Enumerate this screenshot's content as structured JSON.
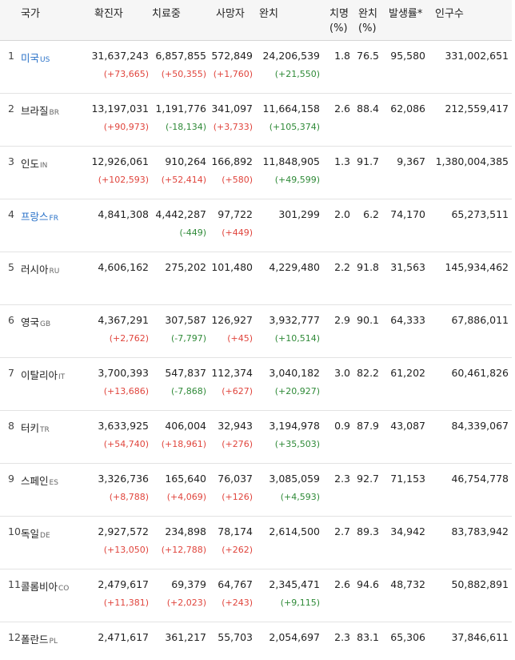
{
  "headers": {
    "country": "국가",
    "confirmed": "확진자",
    "treating": "치료중",
    "deaths": "사망자",
    "recovered": "완치",
    "cfr": "치명\n(%)",
    "recovery_rate": "완치\n(%)",
    "incidence": "발생률*",
    "population": "인구수"
  },
  "rows": [
    {
      "rank": "1",
      "name": "미국",
      "code": "US",
      "link": true,
      "confirmed": "31,637,243",
      "confirmed_delta": "(+73,665)",
      "treating": "6,857,855",
      "treating_delta": "(+50,355)",
      "deaths": "572,849",
      "deaths_delta": "(+1,760)",
      "recovered": "24,206,539",
      "recovered_delta": "(+21,550)",
      "cfr": "1.8",
      "recovery_rate": "76.5",
      "incidence": "95,580",
      "population": "331,002,651"
    },
    {
      "rank": "2",
      "name": "브라질",
      "code": "BR",
      "link": false,
      "confirmed": "13,197,031",
      "confirmed_delta": "(+90,973)",
      "treating": "1,191,776",
      "treating_delta": "(-18,134)",
      "deaths": "341,097",
      "deaths_delta": "(+3,733)",
      "recovered": "11,664,158",
      "recovered_delta": "(+105,374)",
      "cfr": "2.6",
      "recovery_rate": "88.4",
      "incidence": "62,086",
      "population": "212,559,417"
    },
    {
      "rank": "3",
      "name": "인도",
      "code": "IN",
      "link": false,
      "confirmed": "12,926,061",
      "confirmed_delta": "(+102,593)",
      "treating": "910,264",
      "treating_delta": "(+52,414)",
      "deaths": "166,892",
      "deaths_delta": "(+580)",
      "recovered": "11,848,905",
      "recovered_delta": "(+49,599)",
      "cfr": "1.3",
      "recovery_rate": "91.7",
      "incidence": "9,367",
      "population": "1,380,004,385"
    },
    {
      "rank": "4",
      "name": "프랑스",
      "code": "FR",
      "link": true,
      "confirmed": "4,841,308",
      "confirmed_delta": "",
      "treating": "4,442,287",
      "treating_delta": "(-449)",
      "deaths": "97,722",
      "deaths_delta": "(+449)",
      "recovered": "301,299",
      "recovered_delta": "",
      "cfr": "2.0",
      "recovery_rate": "6.2",
      "incidence": "74,170",
      "population": "65,273,511"
    },
    {
      "rank": "5",
      "name": "러시아",
      "code": "RU",
      "link": false,
      "confirmed": "4,606,162",
      "confirmed_delta": "",
      "treating": "275,202",
      "treating_delta": "",
      "deaths": "101,480",
      "deaths_delta": "",
      "recovered": "4,229,480",
      "recovered_delta": "",
      "cfr": "2.2",
      "recovery_rate": "91.8",
      "incidence": "31,563",
      "population": "145,934,462"
    },
    {
      "rank": "6",
      "name": "영국",
      "code": "GB",
      "link": false,
      "confirmed": "4,367,291",
      "confirmed_delta": "(+2,762)",
      "treating": "307,587",
      "treating_delta": "(-7,797)",
      "deaths": "126,927",
      "deaths_delta": "(+45)",
      "recovered": "3,932,777",
      "recovered_delta": "(+10,514)",
      "cfr": "2.9",
      "recovery_rate": "90.1",
      "incidence": "64,333",
      "population": "67,886,011"
    },
    {
      "rank": "7",
      "name": "이탈리아",
      "code": "IT",
      "link": false,
      "confirmed": "3,700,393",
      "confirmed_delta": "(+13,686)",
      "treating": "547,837",
      "treating_delta": "(-7,868)",
      "deaths": "112,374",
      "deaths_delta": "(+627)",
      "recovered": "3,040,182",
      "recovered_delta": "(+20,927)",
      "cfr": "3.0",
      "recovery_rate": "82.2",
      "incidence": "61,202",
      "population": "60,461,826"
    },
    {
      "rank": "8",
      "name": "터키",
      "code": "TR",
      "link": false,
      "confirmed": "3,633,925",
      "confirmed_delta": "(+54,740)",
      "treating": "406,004",
      "treating_delta": "(+18,961)",
      "deaths": "32,943",
      "deaths_delta": "(+276)",
      "recovered": "3,194,978",
      "recovered_delta": "(+35,503)",
      "cfr": "0.9",
      "recovery_rate": "87.9",
      "incidence": "43,087",
      "population": "84,339,067"
    },
    {
      "rank": "9",
      "name": "스페인",
      "code": "ES",
      "link": false,
      "confirmed": "3,326,736",
      "confirmed_delta": "(+8,788)",
      "treating": "165,640",
      "treating_delta": "(+4,069)",
      "deaths": "76,037",
      "deaths_delta": "(+126)",
      "recovered": "3,085,059",
      "recovered_delta": "(+4,593)",
      "cfr": "2.3",
      "recovery_rate": "92.7",
      "incidence": "71,153",
      "population": "46,754,778"
    },
    {
      "rank": "10",
      "name": "독일",
      "code": "DE",
      "link": false,
      "confirmed": "2,927,572",
      "confirmed_delta": "(+13,050)",
      "treating": "234,898",
      "treating_delta": "(+12,788)",
      "deaths": "78,174",
      "deaths_delta": "(+262)",
      "recovered": "2,614,500",
      "recovered_delta": "",
      "cfr": "2.7",
      "recovery_rate": "89.3",
      "incidence": "34,942",
      "population": "83,783,942"
    },
    {
      "rank": "11",
      "name": "콜롬비아",
      "code": "CO",
      "link": false,
      "confirmed": "2,479,617",
      "confirmed_delta": "(+11,381)",
      "treating": "69,379",
      "treating_delta": "(+2,023)",
      "deaths": "64,767",
      "deaths_delta": "(+243)",
      "recovered": "2,345,471",
      "recovered_delta": "(+9,115)",
      "cfr": "2.6",
      "recovery_rate": "94.6",
      "incidence": "48,732",
      "population": "50,882,891"
    },
    {
      "rank": "12",
      "name": "폴란드",
      "code": "PL",
      "link": false,
      "confirmed": "2,471,617",
      "confirmed_delta": "",
      "treating": "361,217",
      "treating_delta": "",
      "deaths": "55,703",
      "deaths_delta": "",
      "recovered": "2,054,697",
      "recovered_delta": "",
      "cfr": "2.3",
      "recovery_rate": "83.1",
      "incidence": "65,306",
      "population": "37,846,611"
    }
  ]
}
